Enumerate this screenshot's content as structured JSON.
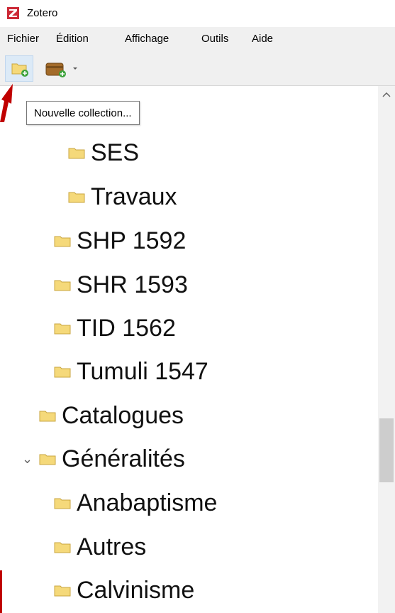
{
  "window": {
    "title": "Zotero"
  },
  "menubar": {
    "items": [
      {
        "label": "Fichier"
      },
      {
        "label": "Édition"
      },
      {
        "label": "Affichage"
      },
      {
        "label": "Outils"
      },
      {
        "label": "Aide"
      }
    ]
  },
  "toolbar": {
    "new_collection_tooltip": "Nouvelle collection..."
  },
  "tree": {
    "items": [
      {
        "label": "SES",
        "level": 3
      },
      {
        "label": "Travaux",
        "level": 3
      },
      {
        "label": "SHP 1592",
        "level": 2
      },
      {
        "label": "SHR 1593",
        "level": 2
      },
      {
        "label": "TID 1562",
        "level": 2
      },
      {
        "label": "Tumuli 1547",
        "level": 2
      },
      {
        "label": "Catalogues",
        "level": 1
      },
      {
        "label": "Généralités",
        "level": 1,
        "expanded": true
      },
      {
        "label": "Anabaptisme",
        "level": 2
      },
      {
        "label": "Autres",
        "level": 2
      },
      {
        "label": "Calvinisme",
        "level": 2
      }
    ]
  },
  "colors": {
    "logo_red": "#cc2936",
    "folder_fill": "#f5d97a",
    "folder_stroke": "#c9a640",
    "pointer_arrow": "#c00000"
  }
}
